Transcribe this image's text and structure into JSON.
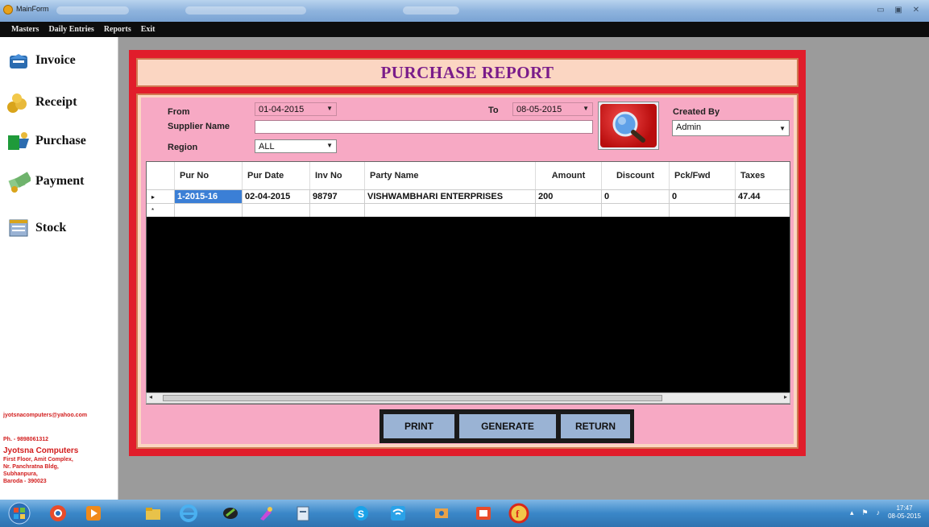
{
  "window": {
    "title": "MainForm",
    "controls": [
      "minimize-icon",
      "maximize-icon",
      "close-icon"
    ]
  },
  "menu": [
    "Masters",
    "Daily Entries",
    "Reports",
    "Exit"
  ],
  "sidebar": {
    "items": [
      {
        "label": "Invoice",
        "icon": "invoice-icon"
      },
      {
        "label": "Receipt",
        "icon": "receipt-icon"
      },
      {
        "label": "Purchase",
        "icon": "purchase-icon"
      },
      {
        "label": "Payment",
        "icon": "payment-icon"
      },
      {
        "label": "Stock",
        "icon": "stock-icon"
      }
    ],
    "contact": {
      "email": "jyotsnacomputers@yahoo.com",
      "phone": "Ph. - 9898061312",
      "company": "Jyotsna Computers",
      "address1": "First Floor, Amit Complex,",
      "address2": "Nr. Panchratna Bldg,",
      "address3": "Subhanpura,",
      "address4": "Baroda - 390023"
    }
  },
  "report": {
    "title": "PURCHASE REPORT",
    "filters": {
      "from_label": "From",
      "from_value": "01-04-2015",
      "to_label": "To",
      "to_value": "08-05-2015",
      "supplier_label": "Supplier Name",
      "supplier_value": "",
      "region_label": "Region",
      "region_value": "ALL",
      "created_by_label": "Created By",
      "created_by_value": "Admin"
    },
    "grid": {
      "columns": [
        "Pur No",
        "Pur Date",
        "Inv No",
        "Party Name",
        "Amount",
        "Discount",
        "Pck/Fwd",
        "Taxes"
      ],
      "rows": [
        [
          "1-2015-16",
          "02-04-2015",
          "98797",
          "VISHWAMBHARI ENTERPRISES",
          "200",
          "0",
          "0",
          "47.44"
        ]
      ],
      "row_markers": [
        "▸",
        "*"
      ]
    },
    "buttons": {
      "print": "PRINT",
      "generate": "GENERATE",
      "return": "RETURN"
    }
  },
  "taskbar": {
    "clock_time": "17:47",
    "clock_date": "08-05-2015"
  }
}
